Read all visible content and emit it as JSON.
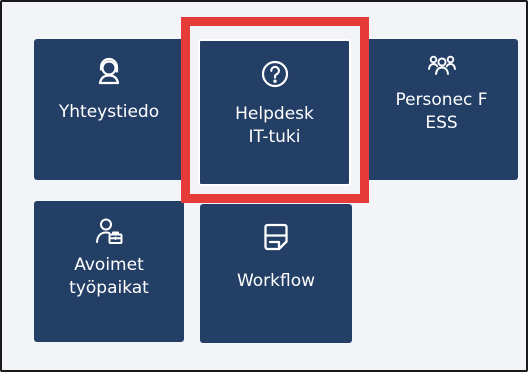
{
  "tiles": {
    "yhteystiedot": {
      "label": "Yhteystiedo",
      "icon": "headset-user-icon"
    },
    "helpdesk": {
      "label_line1": "Helpdesk",
      "label_line2": "IT-tuki",
      "icon": "help-circle-icon"
    },
    "personec": {
      "label_line1": "Personec F",
      "label_line2": "ESS",
      "icon": "people-group-icon"
    },
    "avoimet": {
      "label_line1": "Avoimet",
      "label_line2": "työpaikat",
      "icon": "person-briefcase-icon"
    },
    "workflow": {
      "label": "Workflow",
      "icon": "form-document-icon"
    }
  },
  "highlight": {
    "color": "#e53b3b",
    "target": "helpdesk"
  },
  "colors": {
    "tile_background": "#233f66",
    "page_background": "#f2f4f7",
    "text": "#ffffff"
  }
}
